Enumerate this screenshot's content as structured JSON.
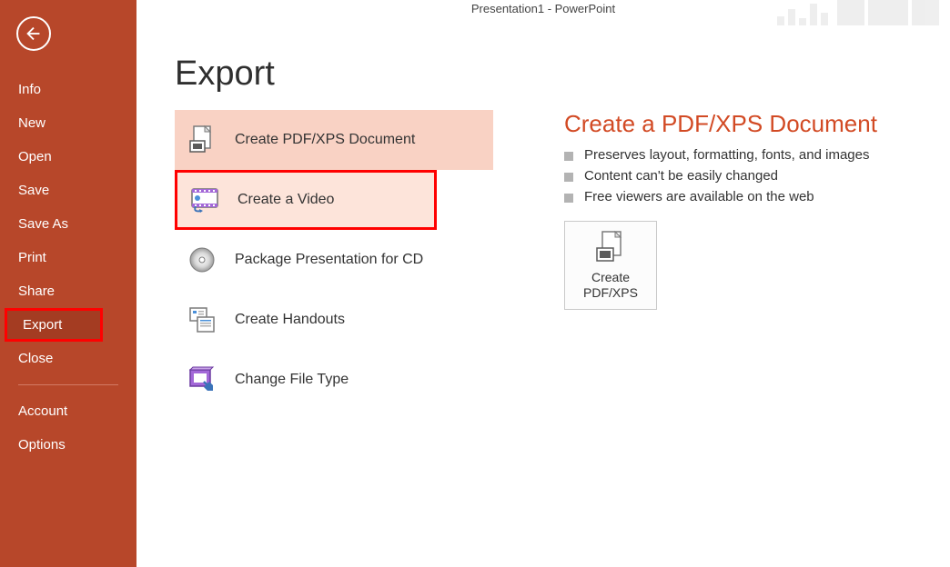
{
  "titlebar": "Presentation1 - PowerPoint",
  "page_title": "Export",
  "nav": {
    "info": "Info",
    "new": "New",
    "open": "Open",
    "save": "Save",
    "saveas": "Save As",
    "print": "Print",
    "share": "Share",
    "export": "Export",
    "close": "Close",
    "account": "Account",
    "options": "Options"
  },
  "options": {
    "pdf": "Create PDF/XPS Document",
    "video": "Create a Video",
    "package": "Package Presentation for CD",
    "handouts": "Create Handouts",
    "filetype": "Change File Type"
  },
  "detail": {
    "title": "Create a PDF/XPS Document",
    "points": {
      "0": "Preserves layout, formatting, fonts, and images",
      "1": "Content can't be easily changed",
      "2": "Free viewers are available on the web"
    },
    "button_line1": "Create",
    "button_line2": "PDF/XPS"
  }
}
